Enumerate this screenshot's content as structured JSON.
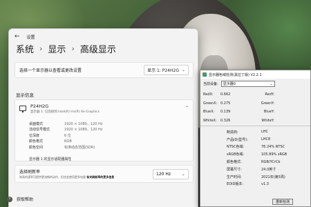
{
  "settings": {
    "window_title": "设置",
    "breadcrumb": [
      "系统",
      "显示",
      "高级显示"
    ],
    "selector": {
      "label": "选择一个显示器以查看或更改设置",
      "value": "显示 1: P24H2G"
    },
    "section_title": "显示信息",
    "display": {
      "name": "P24H2G",
      "subtitle": "显示器 1: 已连接到 Intel(R) Iris(R) Xe Graphics",
      "info": [
        {
          "key": "桌面模式",
          "value": "1920 × 1080，120 Hz"
        },
        {
          "key": "活动信号模式",
          "value": "1920 × 1080，120 Hz"
        },
        {
          "key": "位深度",
          "value": "6 位"
        },
        {
          "key": "颜色格式",
          "value": "RGB"
        },
        {
          "key": "颜色空间",
          "value": "标准动态范围(SDR)"
        }
      ],
      "properties_link": "显示器 1 的显示适配器属性"
    },
    "refresh": {
      "title": "选择刷新率",
      "desc_prefix": "较高的速率可提供更流畅的动作，但也会使用更多电量",
      "desc_emphasis": "有关刷新率的更多信息",
      "value": "120 Hz"
    },
    "help": "获取帮助"
  },
  "tool": {
    "title": "显示器色域检测(黑拉丁版) V2.2.1",
    "monitor_label": "当前设备:",
    "monitor_value": "显示器0",
    "coords": [
      {
        "l": "RedX:",
        "v": "0.662",
        "r": "RedY:"
      },
      {
        "l": "GreenX:",
        "v": "0.275",
        "r": "GreenY:"
      },
      {
        "l": "BlueX:",
        "v": "0.139",
        "r": "BlueY:"
      },
      {
        "l": "WhiteX:",
        "v": "0.326",
        "r": "WhiteY:"
      }
    ],
    "metrics": [
      {
        "k": "制造商:",
        "v": "LHC"
      },
      {
        "k": "产品ID(型号):",
        "v": "LHC8"
      },
      {
        "k": "NTSC色域:",
        "v": "76.24% NTSC"
      },
      {
        "k": "sRGB色域:",
        "v": "105.89% sRGB"
      },
      {
        "k": "颜色格式:",
        "v": "RGB/YCrCb"
      },
      {
        "k": "屏幕尺寸:",
        "v": "24.0英寸"
      },
      {
        "k": "生产时间:",
        "v": "2021年(第5周)"
      },
      {
        "k": "EDID版本:",
        "v": "v1.3"
      }
    ],
    "button": "重新检测"
  }
}
